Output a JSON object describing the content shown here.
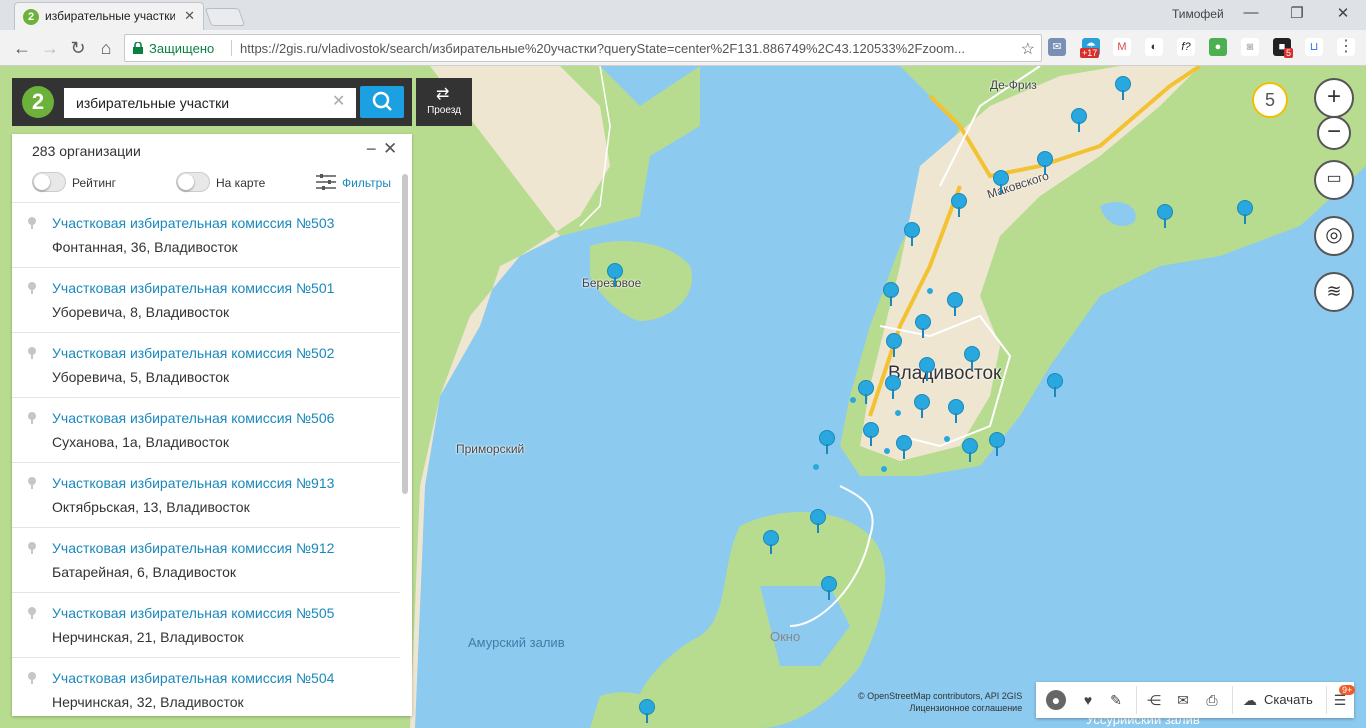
{
  "browser": {
    "tab_title": "избирательные участки",
    "user_name": "Тимофей",
    "secure_label": "Защищено",
    "url": "https://2gis.ru/vladivostok/search/избирательные%20участки?queryState=center%2F131.886749%2C43.120533%2Fzoom...",
    "ext_badge_mail": "+17",
    "ext_badge_other": "5"
  },
  "search": {
    "query": "избирательные участки",
    "logo": "2",
    "route_label": "Проезд"
  },
  "panel": {
    "count": "283 организации",
    "rating_label": "Рейтинг",
    "on_map_label": "На карте",
    "filters_label": "Фильтры",
    "results": [
      {
        "title": "Участковая избирательная комиссия №503",
        "address": "Фонтанная, 36, Владивосток"
      },
      {
        "title": "Участковая избирательная комиссия №501",
        "address": "Уборевича, 8, Владивосток"
      },
      {
        "title": "Участковая избирательная комиссия №502",
        "address": "Уборевича, 5, Владивосток"
      },
      {
        "title": "Участковая избирательная комиссия №506",
        "address": "Суханова, 1а, Владивосток"
      },
      {
        "title": "Участковая избирательная комиссия №913",
        "address": "Октябрьская, 13, Владивосток"
      },
      {
        "title": "Участковая избирательная комиссия №912",
        "address": "Батарейная, 6, Владивосток"
      },
      {
        "title": "Участковая избирательная комиссия №505",
        "address": "Нерчинская, 21, Владивосток"
      },
      {
        "title": "Участковая избирательная комиссия №504",
        "address": "Нерчинская, 32, Владивосток"
      }
    ]
  },
  "map": {
    "zoom_level": "5",
    "labels": {
      "city": "Владивосток",
      "berezovoe": "Березовое",
      "primorsky": "Приморский",
      "de_friz": "Де-Фриз",
      "makovskogo": "Маковского",
      "amursky": "Амурский залив",
      "okno": "Окно",
      "ussuriysky": "Уссурийский залив"
    },
    "copyright": "© OpenStreetMap contributors, API 2GIS",
    "license": "Лицензионное соглашение",
    "download_label": "Скачать",
    "news_badge": "9+",
    "colors": {
      "water": "#8ccaf0",
      "land": "#b7dc8f",
      "city": "#e9dfc9",
      "road": "#f3c233",
      "pin": "#29a8e0"
    }
  }
}
